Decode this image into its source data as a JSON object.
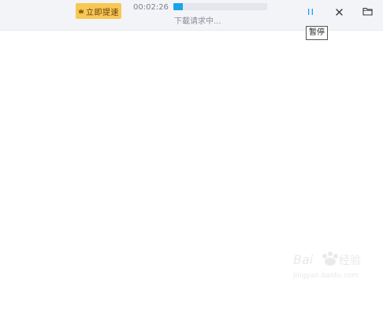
{
  "toolbar": {
    "speed_button_label": "立即提速",
    "elapsed_time": "00:02:26",
    "status_text": "下載请求中...",
    "progress_percent": 10,
    "tooltip_text": "暂停"
  },
  "icons": {
    "crown": "crown-icon",
    "pause": "pause-icon",
    "close": "close-icon",
    "folder": "folder-icon"
  },
  "colors": {
    "accent": "#1aa3e8",
    "speed_button_bg": "#f7c853",
    "topbar_bg": "#f3f4f8"
  },
  "watermark": {
    "brand": "Baidu 经验",
    "url": "jingyan.baidu.com"
  }
}
